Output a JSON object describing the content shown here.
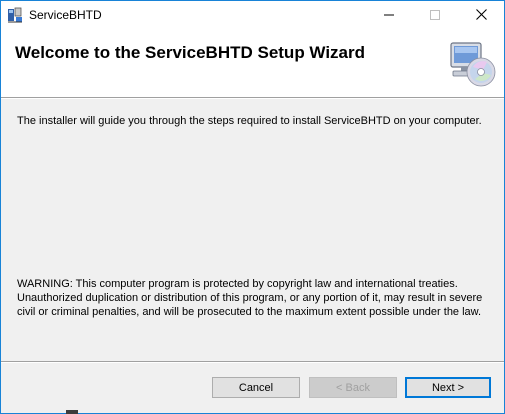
{
  "window": {
    "title": "ServiceBHTD",
    "controls": {
      "minimize_icon": "minimize-icon",
      "maximize_icon": "maximize-icon",
      "close_icon": "close-icon"
    }
  },
  "header": {
    "title": "Welcome to the ServiceBHTD Setup Wizard",
    "graphic_icon": "computer-cd-icon"
  },
  "body": {
    "intro": "The installer will guide you through the steps required to install ServiceBHTD on your computer.",
    "warning": "WARNING: This computer program is protected by copyright law and international treaties. Unauthorized duplication or distribution of this program, or any portion of it, may result in severe civil or criminal penalties, and will be prosecuted to the maximum extent possible under the law."
  },
  "buttons": {
    "cancel": "Cancel",
    "back": "< Back",
    "next": "Next >"
  },
  "colors": {
    "window_border": "#1883d7",
    "background": "#f0f0f0",
    "focus": "#0078d7"
  }
}
